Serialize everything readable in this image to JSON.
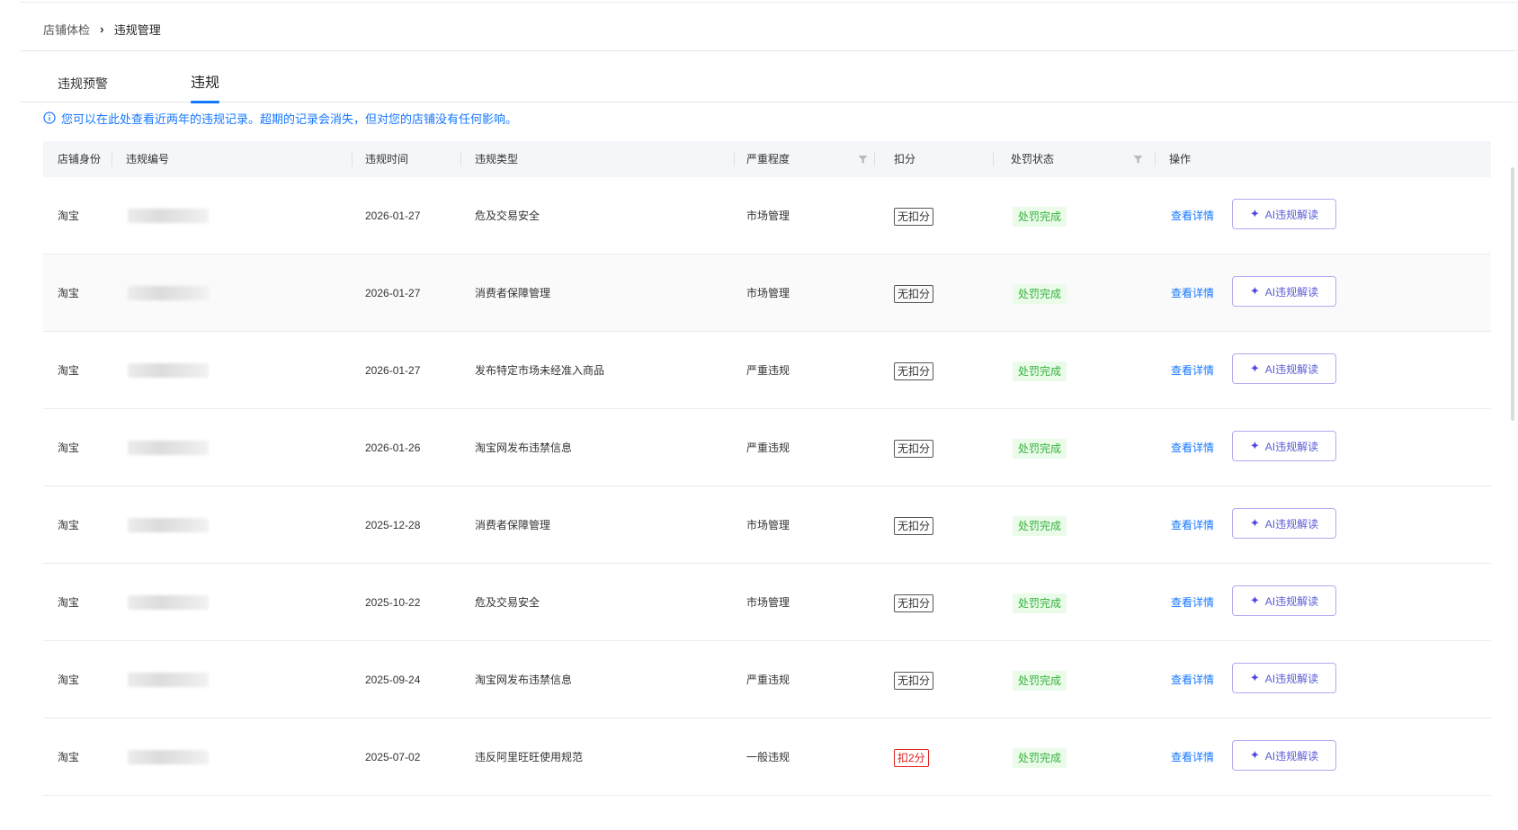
{
  "breadcrumb": {
    "parent": "店铺体检",
    "separator": "›",
    "current": "违规管理"
  },
  "tabs": [
    {
      "label": "违规预警",
      "active": false
    },
    {
      "label": "违规",
      "active": true
    }
  ],
  "notice": "您可以在此处查看近两年的违规记录。超期的记录会消失，但对您的店铺没有任何影响。",
  "table": {
    "headers": {
      "identity": "店铺身份",
      "id": "违规编号",
      "time": "违规时间",
      "type": "违规类型",
      "severity": "严重程度",
      "deduct": "扣分",
      "status": "处罚状态",
      "ops": "操作"
    },
    "rows": [
      {
        "identity": "淘宝",
        "time": "2026-01-27",
        "type": "危及交易安全",
        "severity": "市场管理",
        "deduct": "无扣分",
        "status": "处罚完成",
        "detail": "查看详情",
        "ai": "AI违规解读"
      },
      {
        "identity": "淘宝",
        "time": "2026-01-27",
        "type": "消费者保障管理",
        "severity": "市场管理",
        "deduct": "无扣分",
        "status": "处罚完成",
        "detail": "查看详情",
        "ai": "AI违规解读"
      },
      {
        "identity": "淘宝",
        "time": "2026-01-27",
        "type": "发布特定市场未经准入商品",
        "severity": "严重违规",
        "deduct": "无扣分",
        "status": "处罚完成",
        "detail": "查看详情",
        "ai": "AI违规解读"
      },
      {
        "identity": "淘宝",
        "time": "2026-01-26",
        "type": "淘宝网发布违禁信息",
        "severity": "严重违规",
        "deduct": "无扣分",
        "status": "处罚完成",
        "detail": "查看详情",
        "ai": "AI违规解读"
      },
      {
        "identity": "淘宝",
        "time": "2025-12-28",
        "type": "消费者保障管理",
        "severity": "市场管理",
        "deduct": "无扣分",
        "status": "处罚完成",
        "detail": "查看详情",
        "ai": "AI违规解读"
      },
      {
        "identity": "淘宝",
        "time": "2025-10-22",
        "type": "危及交易安全",
        "severity": "市场管理",
        "deduct": "无扣分",
        "status": "处罚完成",
        "detail": "查看详情",
        "ai": "AI违规解读"
      },
      {
        "identity": "淘宝",
        "time": "2025-09-24",
        "type": "淘宝网发布违禁信息",
        "severity": "严重违规",
        "deduct": "无扣分",
        "status": "处罚完成",
        "detail": "查看详情",
        "ai": "AI违规解读"
      },
      {
        "identity": "淘宝",
        "time": "2025-07-02",
        "type": "违反阿里旺旺使用规范",
        "severity": "一般违规",
        "deduct": "扣2分",
        "status": "处罚完成",
        "detail": "查看详情",
        "ai": "AI违规解读"
      }
    ]
  },
  "colors": {
    "accent": "#1677ff",
    "status_green": "#34b23a",
    "deduct_red": "#e02020",
    "ai_border": "#b7a8f0"
  },
  "icons": {
    "info": "info-circle-icon",
    "filter": "filter-icon",
    "ai": "sparkle-icon"
  }
}
